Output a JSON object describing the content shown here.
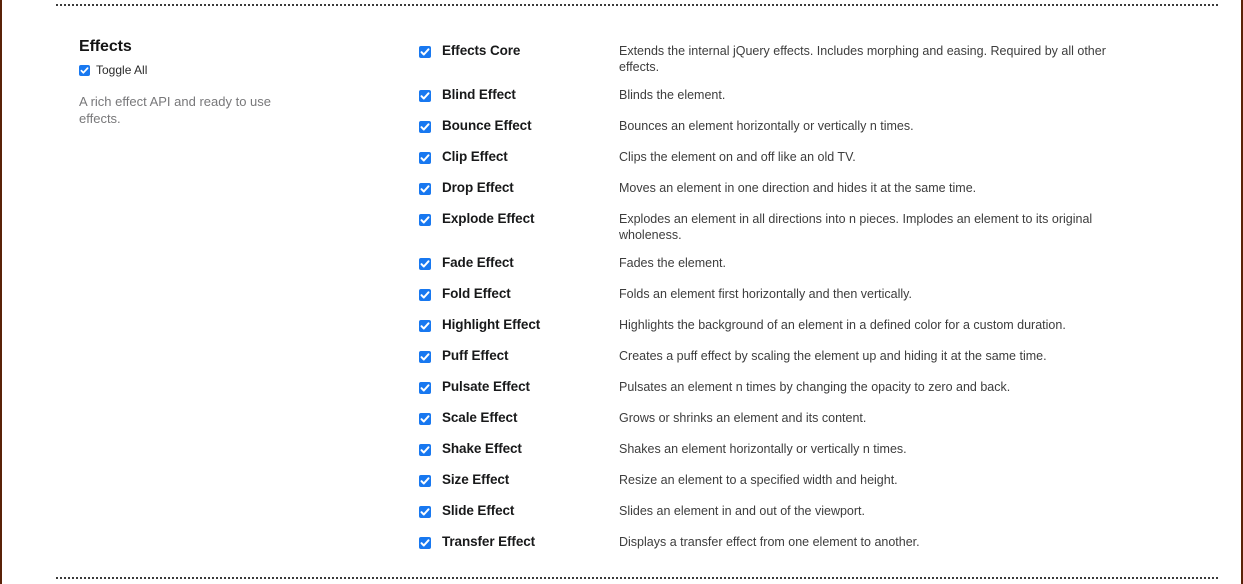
{
  "frame": {
    "edge_color": "#5a2208",
    "dotted_rule_color": "#3a3a3a"
  },
  "sidebar": {
    "title": "Effects",
    "toggle_all_label": "Toggle All",
    "toggle_all_checked": true,
    "description": "A rich effect API and ready to use effects."
  },
  "checkbox": {
    "icon": "checkbox-checked-icon",
    "accent_color": "#1878f0",
    "check_color": "#ffffff"
  },
  "effects": [
    {
      "name": "Effects Core",
      "description": "Extends the internal jQuery effects. Includes morphing and easing. Required by all other effects.",
      "checked": true,
      "two_line": true
    },
    {
      "name": "Blind Effect",
      "description": "Blinds the element.",
      "checked": true,
      "two_line": false
    },
    {
      "name": "Bounce Effect",
      "description": "Bounces an element horizontally or vertically n times.",
      "checked": true,
      "two_line": false
    },
    {
      "name": "Clip Effect",
      "description": "Clips the element on and off like an old TV.",
      "checked": true,
      "two_line": false
    },
    {
      "name": "Drop Effect",
      "description": "Moves an element in one direction and hides it at the same time.",
      "checked": true,
      "two_line": false
    },
    {
      "name": "Explode Effect",
      "description": "Explodes an element in all directions into n pieces. Implodes an element to its original wholeness.",
      "checked": true,
      "two_line": true
    },
    {
      "name": "Fade Effect",
      "description": "Fades the element.",
      "checked": true,
      "two_line": false
    },
    {
      "name": "Fold Effect",
      "description": "Folds an element first horizontally and then vertically.",
      "checked": true,
      "two_line": false
    },
    {
      "name": "Highlight Effect",
      "description": "Highlights the background of an element in a defined color for a custom duration.",
      "checked": true,
      "two_line": false
    },
    {
      "name": "Puff Effect",
      "description": "Creates a puff effect by scaling the element up and hiding it at the same time.",
      "checked": true,
      "two_line": false
    },
    {
      "name": "Pulsate Effect",
      "description": "Pulsates an element n times by changing the opacity to zero and back.",
      "checked": true,
      "two_line": false
    },
    {
      "name": "Scale Effect",
      "description": "Grows or shrinks an element and its content.",
      "checked": true,
      "two_line": false
    },
    {
      "name": "Shake Effect",
      "description": "Shakes an element horizontally or vertically n times.",
      "checked": true,
      "two_line": false
    },
    {
      "name": "Size Effect",
      "description": "Resize an element to a specified width and height.",
      "checked": true,
      "two_line": false
    },
    {
      "name": "Slide Effect",
      "description": "Slides an element in and out of the viewport.",
      "checked": true,
      "two_line": false
    },
    {
      "name": "Transfer Effect",
      "description": "Displays a transfer effect from one element to another.",
      "checked": true,
      "two_line": false
    }
  ]
}
